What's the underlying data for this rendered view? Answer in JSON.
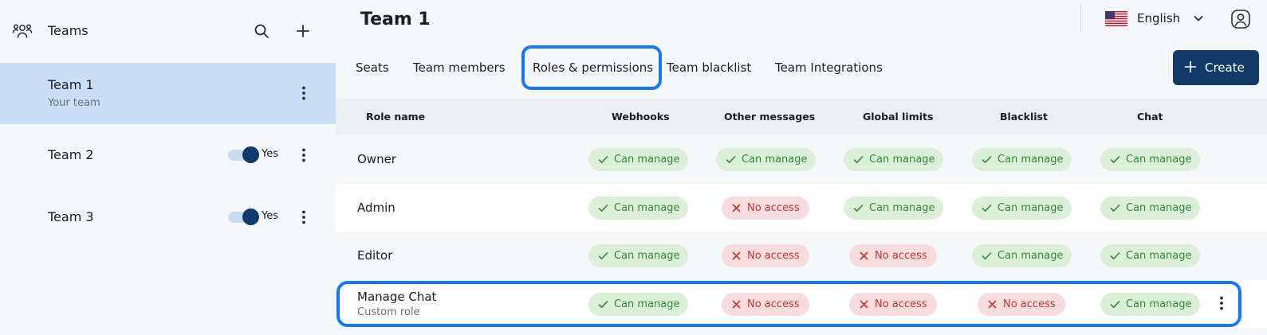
{
  "sidebar": {
    "title": "Teams",
    "teams": [
      {
        "name": "Team 1",
        "subtitle": "Your team",
        "selected": true
      },
      {
        "name": "Team 2",
        "toggle_label": "Yes",
        "toggle_on": true
      },
      {
        "name": "Team 3",
        "toggle_label": "Yes",
        "toggle_on": true
      }
    ]
  },
  "header": {
    "title": "Team 1",
    "language": "English"
  },
  "tabs": [
    {
      "label": "Seats"
    },
    {
      "label": "Team members"
    },
    {
      "label": "Roles & permissions",
      "active": true
    },
    {
      "label": "Team blacklist"
    },
    {
      "label": "Team Integrations"
    }
  ],
  "create_label": "Create",
  "table": {
    "columns": [
      "Role name",
      "Webhooks",
      "Other messages",
      "Global limits",
      "Blacklist",
      "Chat"
    ],
    "rows": [
      {
        "name": "Owner",
        "cells": [
          "Can manage",
          "Can manage",
          "Can manage",
          "Can manage",
          "Can manage"
        ]
      },
      {
        "name": "Admin",
        "cells": [
          "Can manage",
          "No access",
          "Can manage",
          "Can manage",
          "Can manage"
        ]
      },
      {
        "name": "Editor",
        "cells": [
          "Can manage",
          "No access",
          "No access",
          "Can manage",
          "Can manage"
        ]
      },
      {
        "name": "Manage Chat",
        "subtitle": "Custom role",
        "cells": [
          "Can manage",
          "No access",
          "No access",
          "No access",
          "Can manage"
        ]
      }
    ]
  },
  "colors": {
    "accent": "#1478ff",
    "primary_button": "#103a68",
    "selected_bg": "#cadff6",
    "ok_bg": "#dcefd9",
    "ok_fg": "#2f8a37",
    "no_bg": "#f6dcdc",
    "no_fg": "#c93434"
  }
}
